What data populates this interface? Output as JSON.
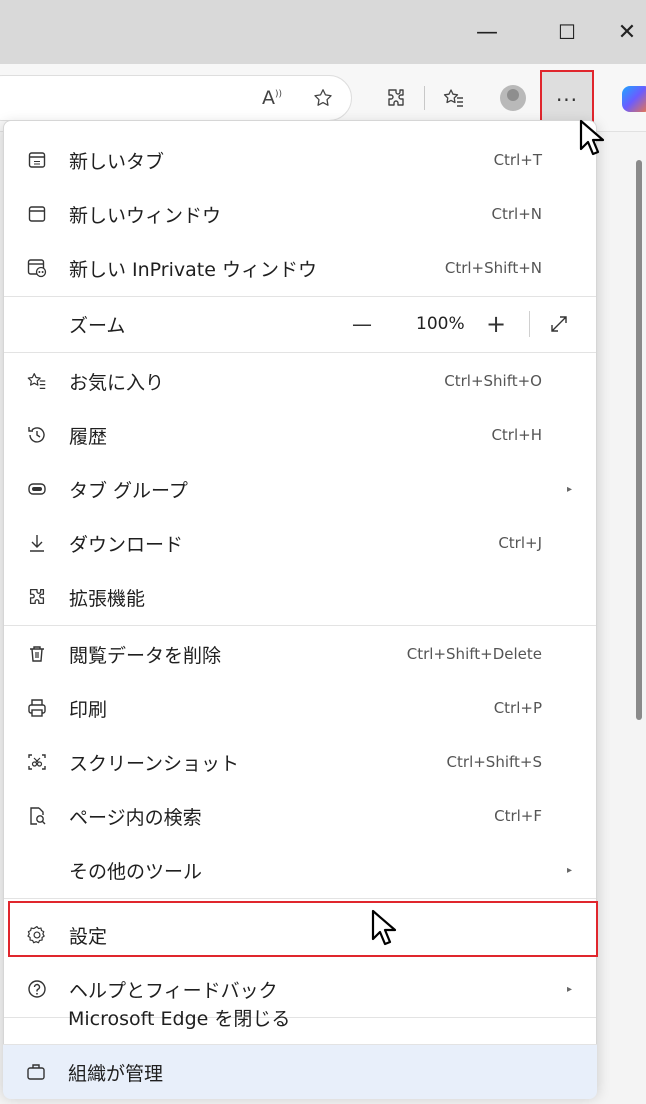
{
  "window": {
    "minimize_glyph": "—",
    "maximize_glyph": "☐",
    "close_glyph": "✕"
  },
  "toolbar": {
    "read_aloud_glyph": "A",
    "more_glyph": "···",
    "icons": [
      "read-aloud-icon",
      "favorite-star-icon",
      "extensions-icon",
      "favorites-bar-icon",
      "profile-avatar-icon",
      "more-options-icon",
      "copilot-icon"
    ]
  },
  "menu": {
    "new_tab": {
      "label": "新しいタブ",
      "shortcut": "Ctrl+T"
    },
    "new_window": {
      "label": "新しいウィンドウ",
      "shortcut": "Ctrl+N"
    },
    "new_inprivate": {
      "label": "新しい InPrivate ウィンドウ",
      "shortcut": "Ctrl+Shift+N"
    },
    "zoom": {
      "label": "ズーム",
      "minus": "—",
      "value": "100%",
      "plus": "+",
      "fullscreen_glyph": "⤢"
    },
    "favorites": {
      "label": "お気に入り",
      "shortcut": "Ctrl+Shift+O"
    },
    "history": {
      "label": "履歴",
      "shortcut": "Ctrl+H"
    },
    "tab_groups": {
      "label": "タブ グループ",
      "arrow": "▸"
    },
    "downloads": {
      "label": "ダウンロード",
      "shortcut": "Ctrl+J"
    },
    "extensions": {
      "label": "拡張機能"
    },
    "clear_data": {
      "label": "閲覧データを削除",
      "shortcut": "Ctrl+Shift+Delete"
    },
    "print": {
      "label": "印刷",
      "shortcut": "Ctrl+P"
    },
    "screenshot": {
      "label": "スクリーンショット",
      "shortcut": "Ctrl+Shift+S"
    },
    "find": {
      "label": "ページ内の検索",
      "shortcut": "Ctrl+F"
    },
    "more_tools": {
      "label": "その他のツール",
      "arrow": "▸"
    },
    "settings": {
      "label": "設定"
    },
    "help": {
      "label": "ヘルプとフィードバック",
      "arrow": "▸"
    },
    "close_edge": {
      "label": "Microsoft Edge を閉じる"
    },
    "managed": {
      "label": "組織が管理"
    }
  },
  "colors": {
    "highlight_border": "#e0262d",
    "managed_bg": "#e8effa",
    "menu_bg": "#ffffff"
  }
}
